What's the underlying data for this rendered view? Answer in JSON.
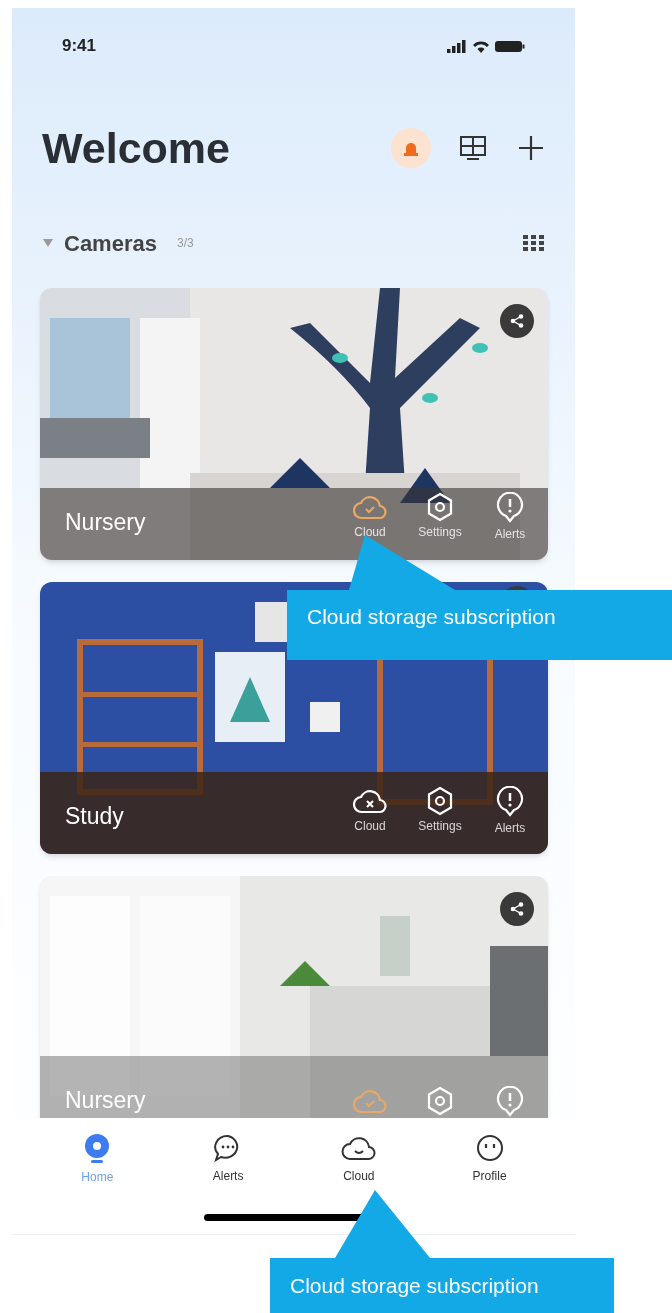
{
  "status_bar": {
    "time": "9:41"
  },
  "header": {
    "title": "Welcome",
    "alarm_active": true
  },
  "section": {
    "title": "Cameras",
    "count": "3/3",
    "expanded": true
  },
  "cameras": [
    {
      "name": "Nursery",
      "cloud_subscribed": true,
      "actions": [
        {
          "kind": "cloud",
          "label": "Cloud"
        },
        {
          "kind": "settings",
          "label": "Settings"
        },
        {
          "kind": "alerts",
          "label": "Alerts"
        }
      ]
    },
    {
      "name": "Study",
      "cloud_subscribed": false,
      "actions": [
        {
          "kind": "cloud",
          "label": "Cloud"
        },
        {
          "kind": "settings",
          "label": "Settings"
        },
        {
          "kind": "alerts",
          "label": "Alerts"
        }
      ]
    },
    {
      "name": "Nursery",
      "cloud_subscribed": true,
      "actions": [
        {
          "kind": "cloud"
        },
        {
          "kind": "settings"
        },
        {
          "kind": "alerts"
        }
      ]
    }
  ],
  "tab_bar": [
    {
      "kind": "home",
      "label": "Home",
      "selected": true
    },
    {
      "kind": "alerts",
      "label": "Alerts",
      "selected": false
    },
    {
      "kind": "cloud",
      "label": "Cloud",
      "selected": false
    },
    {
      "kind": "profile",
      "label": "Profile",
      "selected": false
    }
  ],
  "callouts": [
    {
      "text": "Cloud storage subscription"
    },
    {
      "text": "Cloud storage subscription"
    }
  ]
}
